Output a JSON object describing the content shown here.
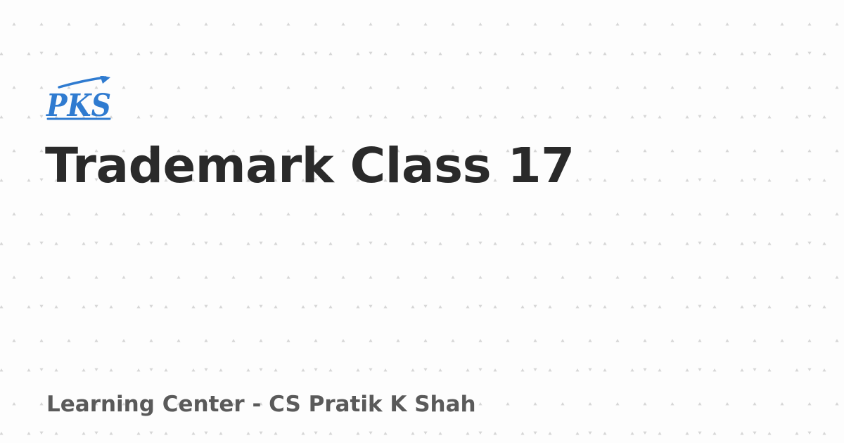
{
  "logo": {
    "text": "PKS",
    "color": "#2f7bd0",
    "icon": "pks-arrow-logo"
  },
  "title": "Trademark Class 17",
  "footer": "Learning Center - CS Pratik K Shah",
  "colors": {
    "background": "#fdfdfd",
    "pattern": "#d4d4d4",
    "title": "#2a2a2a",
    "footer": "#5a5a5a"
  }
}
